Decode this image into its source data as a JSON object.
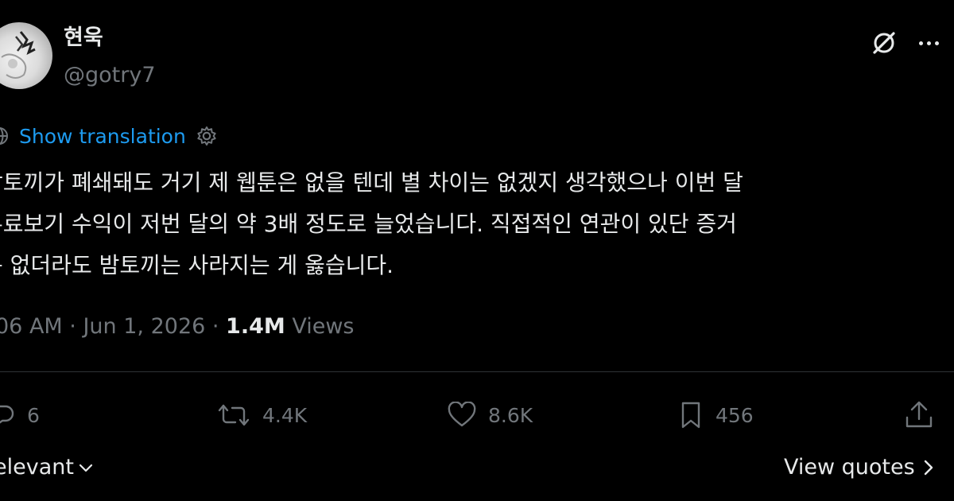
{
  "user": {
    "display_name": "현욱",
    "handle": "@gotry7"
  },
  "translation": {
    "label": "Show translation"
  },
  "tweet": {
    "lines": [
      "밤토끼가 폐쇄돼도 거기 제 웹툰은 없을 텐데 별 차이는 없겠지 생각했으나 이번 달",
      "유료보기 수익이 저번 달의 약 3배 정도로 늘었습니다. 직접적인 연관이 있단 증거",
      "는 없더라도 밤토끼는 사라지는 게 옳습니다."
    ]
  },
  "meta": {
    "time": "06 AM",
    "separator": " · ",
    "date": "Jun 1, 2026",
    "views_count": "1.4M",
    "views_label": " Views"
  },
  "actions": {
    "reply_count": "6",
    "retweet_count": "4.4K",
    "like_count": "8.6K",
    "bookmark_count": "456"
  },
  "footer": {
    "sort_label": "elevant",
    "view_quotes_label": "View quotes"
  },
  "icons": {
    "globe": "globe-icon",
    "settings": "gear-icon",
    "grok": "grok-icon",
    "more": "more-icon",
    "reply": "reply-icon",
    "retweet": "retweet-icon",
    "like": "heart-icon",
    "bookmark": "bookmark-icon",
    "share": "share-icon"
  },
  "colors": {
    "background": "#000000",
    "text": "#e7e9ea",
    "muted": "#71767b",
    "link": "#1d9bf0",
    "divider": "#2f3336"
  }
}
